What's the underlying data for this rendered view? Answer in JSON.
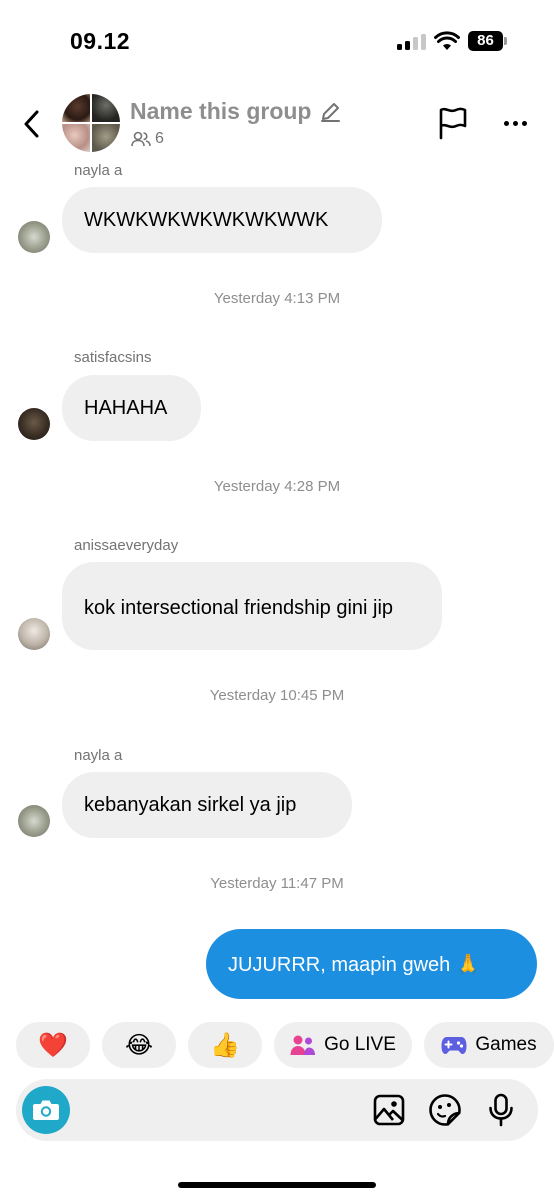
{
  "status_bar": {
    "time": "09.12",
    "battery": "86"
  },
  "header": {
    "group_name": "Name this group",
    "member_count": "6"
  },
  "messages": [
    {
      "sender": "nayla a",
      "text": "WKWKWKWKWKWKWWK"
    },
    {
      "timestamp": "Yesterday 4:13 PM"
    },
    {
      "sender": "satisfacsins",
      "text": "HAHAHA"
    },
    {
      "timestamp": "Yesterday 4:28 PM"
    },
    {
      "sender": "anissaeveryday",
      "text": "kok intersectional friendship gini jip"
    },
    {
      "timestamp": "Yesterday 10:45 PM"
    },
    {
      "sender": "nayla a",
      "text": "kebanyakan sirkel ya jip"
    },
    {
      "timestamp": "Yesterday 11:47 PM"
    },
    {
      "own": true,
      "text": "JUJURRR, maapin gweh 🙏"
    }
  ],
  "quick_replies": [
    {
      "emoji": "❤️",
      "icon": "heart-icon"
    },
    {
      "emoji": "😂",
      "icon": "laughing-face-icon"
    },
    {
      "emoji": "👍",
      "icon": "thumbs-up-icon"
    },
    {
      "label": "Go LIVE",
      "icon": "people-live-icon"
    },
    {
      "label": "Games",
      "icon": "gamepad-icon"
    }
  ],
  "composer": {
    "icons": [
      "camera-icon",
      "gallery-icon",
      "sticker-icon",
      "microphone-icon"
    ]
  },
  "colors": {
    "own_bubble": "#1d8fe0",
    "other_bubble": "#efefef",
    "camera_button": "#20a8c8",
    "live_icon": "#e84393",
    "games_icon": "#5b5fe0"
  }
}
